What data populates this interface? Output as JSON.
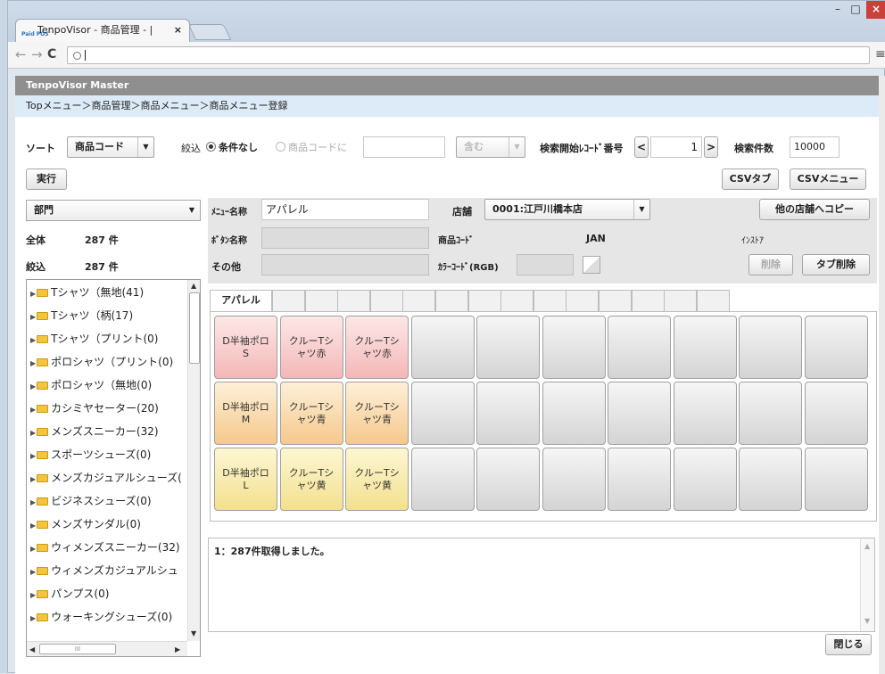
{
  "browser": {
    "tab_title": "TenpoVisor - 商品管理 - |",
    "tab_favicon": "Paid POS",
    "tab_close": "×",
    "window_min": "–",
    "window_max": "□",
    "window_close": "×",
    "back": "←",
    "forward": "→",
    "reload": "C",
    "omnibox_value": "",
    "search_icon": "search-icon",
    "menu": "≡"
  },
  "app": {
    "title": "TenpoVisor Master",
    "breadcrumb": "Topメニュー＞商品管理＞商品メニュー＞商品メニュー登録"
  },
  "filter": {
    "sort_label": "ソート",
    "sort_value": "商品コード",
    "narrow_label": "絞込",
    "radio_none": "条件なし",
    "radio_code": "商品コードに",
    "code_input": "",
    "contains_value": "含む",
    "start_record_label": "検索開始ﾚｺｰﾄﾞ番号",
    "prev": "<",
    "start_record_value": "1",
    "next": ">",
    "count_label": "検索件数",
    "count_value": "10000",
    "execute_label": "実行",
    "csv_tab_label": "CSVタブ",
    "csv_menu_label": "CSVメニュー"
  },
  "left": {
    "department_value": "部門",
    "total_label": "全体",
    "total_count": "287 件",
    "narrow_label": "絞込",
    "narrow_count": "287 件",
    "tree_items": [
      "Tシャツ（無地(41)",
      "Tシャツ（柄(17)",
      "Tシャツ（プリント(0)",
      "ポロシャツ（プリント(0)",
      "ポロシャツ（無地(0)",
      "カシミヤセーター(20)",
      "メンズスニーカー(32)",
      "スポーツシューズ(0)",
      "メンズカジュアルシューズ(",
      "ビジネスシューズ(0)",
      "メンズサンダル(0)",
      "ウィメンズスニーカー(32)",
      "ウィメンズカジュアルシュ",
      "パンプス(0)",
      "ウォーキングシューズ(0)"
    ],
    "scroll_grip": "III"
  },
  "detail": {
    "menu_name_label": "ﾒﾆｭｰ名称",
    "menu_name_value": "アパレル",
    "store_label": "店舗",
    "store_value": "0001:江戸川橋本店",
    "copy_button": "他の店舗へコピー",
    "button_name_label": "ﾎﾞﾀﾝ名称",
    "product_code_label": "商品ｺｰﾄﾞ",
    "jan_label": "JAN",
    "instore_label": "ｲﾝｽﾄｱ",
    "other_label": "その他",
    "color_code_label": "ｶﾗｰｺｰﾄﾞ(RGB)",
    "delete_button": "削除",
    "tab_delete_button": "タブ削除"
  },
  "tabs": {
    "active": "アパレル"
  },
  "buttons": [
    [
      "D半袖ポロ\nS",
      "クルーTシ\nャツ赤",
      "クルーTシ\nャツ赤",
      "",
      "",
      "",
      "",
      "",
      "",
      ""
    ],
    [
      "D半袖ポロ\nM",
      "クルーTシ\nャツ青",
      "クルーTシ\nャツ青",
      "",
      "",
      "",
      "",
      "",
      "",
      ""
    ],
    [
      "D半袖ポロ\nL",
      "クルーTシ\nャツ黄",
      "クルーTシ\nャツ黄",
      "",
      "",
      "",
      "",
      "",
      "",
      ""
    ]
  ],
  "log": {
    "message": "1：287件取得しました。"
  },
  "footer": {
    "close_label": "閉じる"
  }
}
